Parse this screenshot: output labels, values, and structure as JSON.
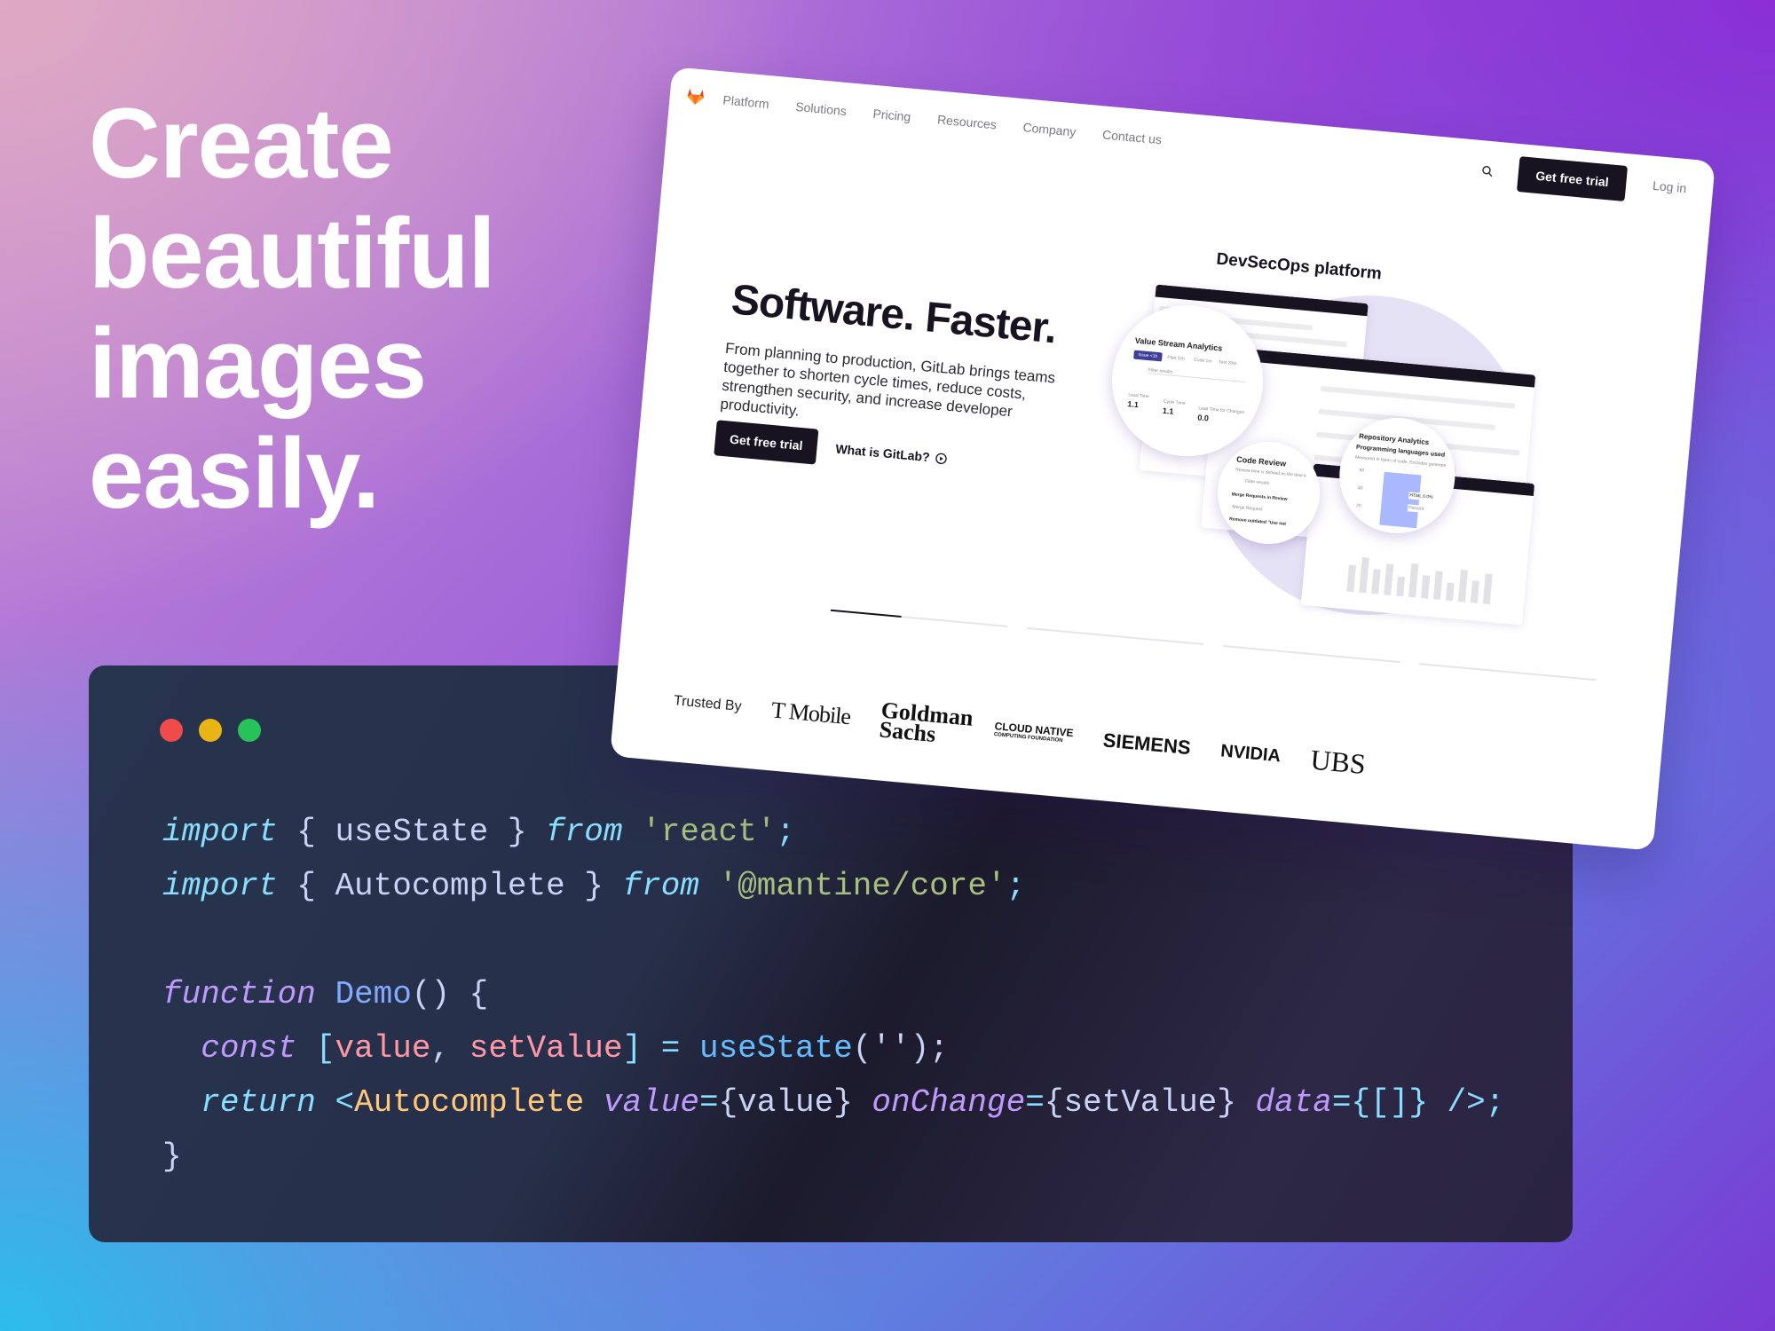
{
  "hero": {
    "lines": [
      "Create",
      "beautiful",
      "images",
      "easily."
    ]
  },
  "window_dots": {
    "colors": [
      "#f04b4b",
      "#e9b414",
      "#27c35a"
    ]
  },
  "code": {
    "lines": [
      [
        [
          "import",
          "#89ddff",
          1
        ],
        [
          " { ",
          "#c8d3f5",
          0
        ],
        [
          "useState",
          "#c8d3f5",
          0
        ],
        [
          " } ",
          "#c8d3f5",
          0
        ],
        [
          "from",
          "#89ddff",
          1
        ],
        [
          " ",
          "#c8d3f5",
          0
        ],
        [
          "'react'",
          "#a7c080",
          0
        ],
        [
          ";",
          "#89ddff",
          0
        ]
      ],
      [
        [
          "import",
          "#89ddff",
          1
        ],
        [
          " { ",
          "#c8d3f5",
          0
        ],
        [
          "Autocomplete",
          "#c8d3f5",
          0
        ],
        [
          " } ",
          "#c8d3f5",
          0
        ],
        [
          "from",
          "#89ddff",
          1
        ],
        [
          " ",
          "#c8d3f5",
          0
        ],
        [
          "'@mantine/core'",
          "#a7c080",
          0
        ],
        [
          ";",
          "#89ddff",
          0
        ]
      ],
      [],
      [
        [
          "function",
          "#c099ff",
          1
        ],
        [
          " ",
          "#c8d3f5",
          0
        ],
        [
          "Demo",
          "#82aaff",
          0
        ],
        [
          "() {",
          "#c8d3f5",
          0
        ]
      ],
      [
        [
          "  ",
          "#c8d3f5",
          0
        ],
        [
          "const",
          "#c099ff",
          1
        ],
        [
          " [",
          "#89ddff",
          0
        ],
        [
          "value",
          "#ff98a4",
          0
        ],
        [
          ", ",
          "#c8d3f5",
          0
        ],
        [
          "setValue",
          "#ff98a4",
          0
        ],
        [
          "]",
          "#89ddff",
          0
        ],
        [
          " = ",
          "#89ddff",
          0
        ],
        [
          "useState",
          "#65bcff",
          0
        ],
        [
          "('');",
          "#c8d3f5",
          0
        ]
      ],
      [
        [
          "  ",
          "#c8d3f5",
          0
        ],
        [
          "return",
          "#89ddff",
          1
        ],
        [
          " <",
          "#89ddff",
          0
        ],
        [
          "Autocomplete",
          "#ffc777",
          0
        ],
        [
          " ",
          "#c8d3f5",
          0
        ],
        [
          "value",
          "#c099ff",
          1
        ],
        [
          "=",
          "#89ddff",
          0
        ],
        [
          "{value}",
          "#c8d3f5",
          0
        ],
        [
          " ",
          "#c8d3f5",
          0
        ],
        [
          "onChange",
          "#c099ff",
          1
        ],
        [
          "=",
          "#89ddff",
          0
        ],
        [
          "{setValue}",
          "#c8d3f5",
          0
        ],
        [
          " ",
          "#c8d3f5",
          0
        ],
        [
          "data",
          "#c099ff",
          1
        ],
        [
          "=",
          "#89ddff",
          0
        ],
        [
          "{[]}",
          "#89ddff",
          0
        ],
        [
          " />;",
          "#89ddff",
          0
        ]
      ],
      [
        [
          "}",
          "#c8d3f5",
          0
        ]
      ]
    ]
  },
  "site": {
    "logo_icon": "gitlab-tanuki-icon",
    "nav": [
      "Platform",
      "Solutions",
      "Pricing",
      "Resources",
      "Company",
      "Contact us"
    ],
    "search_icon": "search-icon",
    "cta_header": "Get free trial",
    "login": "Log in",
    "headline": "Software. Faster.",
    "subtext": "From planning to production, GitLab brings teams together to shorten cycle times, reduce costs, strengthen security, and increase developer productivity.",
    "cta_primary": "Get free trial",
    "cta_secondary": "What is GitLab?",
    "illustration": {
      "title": "DevSecOps platform",
      "vsa": {
        "title": "Value Stream Analytics",
        "tabs": [
          "Issue <1h",
          "Plan 2ch",
          "Code 1m",
          "Test 20m"
        ],
        "filter": "Filter results",
        "metrics": [
          {
            "label": "Lead Time",
            "value": "1.1",
            "unit": "days"
          },
          {
            "label": "Cycle Time",
            "value": "1.1",
            "unit": "days"
          },
          {
            "label": "Lead Time for Changes",
            "value": "0.0",
            "unit": "days"
          }
        ]
      },
      "code_review": {
        "title": "Code Review",
        "desc": "Review time is defined as the time it",
        "filter": "Filter results",
        "items": [
          "Merge Requests in Review",
          "Merge Request",
          "Remove outdated \"Use not"
        ]
      },
      "repo": {
        "title": "Repository Analytics",
        "subtitle": "Programming languages used",
        "desc": "Measured in bytes of code. Excludes generate",
        "ticks": [
          "60",
          "40",
          "20"
        ],
        "legend": [
          "HTML 0.0%",
          "Percent"
        ]
      }
    },
    "carousel": {
      "count": 4,
      "active": 0,
      "active_progress": 0.4
    },
    "trusted_by": "Trusted By",
    "logos": [
      "T Mobile",
      "Goldman Sachs",
      "CLOUD NATIVE",
      "COMPUTING FOUNDATION",
      "SIEMENS",
      "NVIDIA",
      "UBS"
    ]
  },
  "colors": {
    "accent_orange": "#fc6d26",
    "dark": "#171321",
    "chart_bar": "#a9b8ff",
    "vsa_tab": "#3f3f9a"
  }
}
